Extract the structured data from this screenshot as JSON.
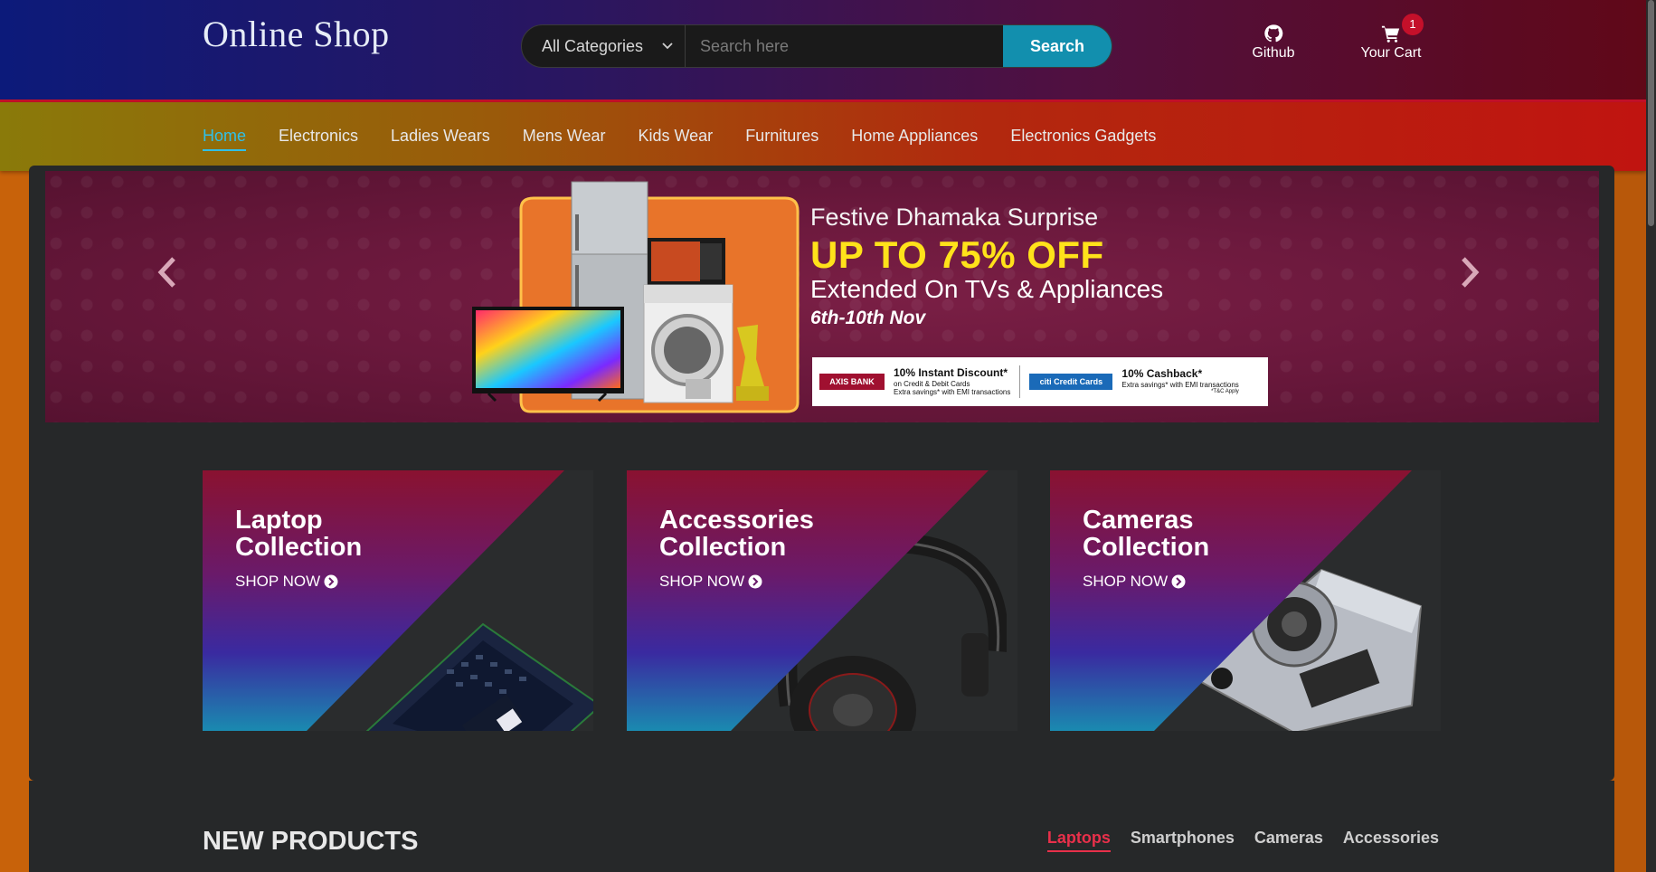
{
  "header": {
    "logo": "Online Shop",
    "search": {
      "category": "All Categories",
      "placeholder": "Search here",
      "button": "Search"
    },
    "github_label": "Github",
    "cart_label": "Your Cart",
    "cart_count": "1"
  },
  "nav": {
    "items": [
      "Home",
      "Electronics",
      "Ladies Wears",
      "Mens Wear",
      "Kids Wear",
      "Furnitures",
      "Home Appliances",
      "Electronics Gadgets"
    ],
    "active": "Home"
  },
  "banner": {
    "subtitle": "Festive Dhamaka Surprise",
    "headline": "UP TO 75% OFF",
    "extended": "Extended On TVs & Appliances",
    "dates": "6th-10th Nov",
    "offer1_bank": "AXIS BANK",
    "offer1_title": "10% Instant Discount*",
    "offer1_line1": "on Credit & Debit Cards",
    "offer1_line2": "Extra savings* with EMI transactions",
    "offer2_bank": "citi Credit Cards",
    "offer2_title": "10% Cashback*",
    "offer2_line1": "Extra savings* with EMI transactions",
    "offer2_note": "*T&C Apply"
  },
  "collections": [
    {
      "line1": "Laptop",
      "line2": "Collection",
      "cta": "SHOP NOW"
    },
    {
      "line1": "Accessories",
      "line2": "Collection",
      "cta": "SHOP NOW"
    },
    {
      "line1": "Cameras",
      "line2": "Collection",
      "cta": "SHOP NOW"
    }
  ],
  "new_products": {
    "title": "NEW PRODUCTS",
    "tabs": [
      "Laptops",
      "Smartphones",
      "Cameras",
      "Accessories"
    ],
    "active": "Laptops"
  },
  "colors": {
    "accent": "#128fae",
    "nav_active": "#2fc0e8",
    "tab_active": "#e8304a",
    "headline": "#ffe21a"
  },
  "icons": [
    "chevron-down-icon",
    "github-icon",
    "cart-icon",
    "chevron-left-icon",
    "chevron-right-icon",
    "arrow-circle-right-icon"
  ]
}
